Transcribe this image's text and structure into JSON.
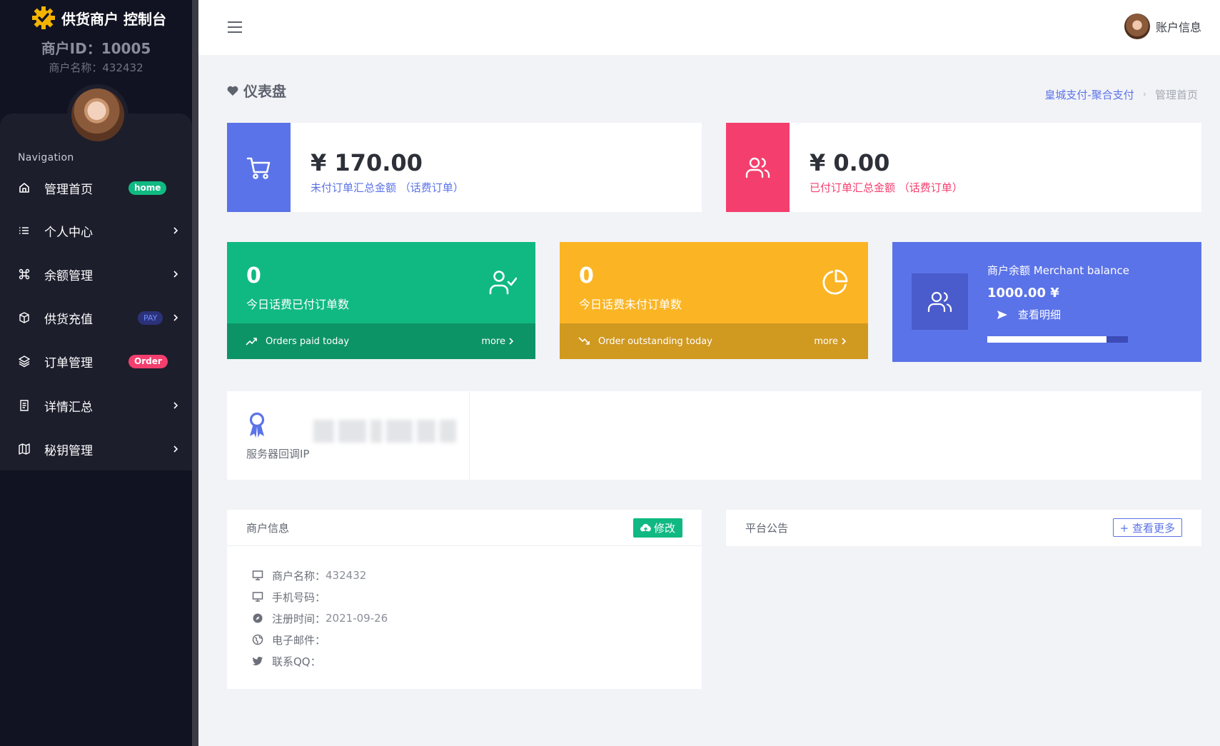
{
  "sidebar": {
    "brand_title": "供货商户 控制台",
    "merchant_id": "商户ID：10005",
    "merchant_name": "商户名称：432432",
    "nav_heading": "Navigation",
    "items": [
      {
        "label": "管理首页",
        "icon": "home-icon",
        "badge": "home"
      },
      {
        "label": "个人中心",
        "icon": "list-icon"
      },
      {
        "label": "余额管理",
        "icon": "command-icon"
      },
      {
        "label": "供货充值",
        "icon": "box-icon",
        "badge": "PAY"
      },
      {
        "label": "订单管理",
        "icon": "layers-icon",
        "badge": "Order"
      },
      {
        "label": "详情汇总",
        "icon": "document-icon"
      },
      {
        "label": "秘钥管理",
        "icon": "map-icon"
      }
    ]
  },
  "topbar": {
    "user_label": "账户信息"
  },
  "page": {
    "title": "仪表盘",
    "breadcrumb": {
      "link": "皇城支付-聚合支付",
      "current": "管理首页"
    }
  },
  "summary": {
    "unpaid": {
      "amount": "¥ 170.00",
      "label": "未付订单汇总金额 （话费订单）",
      "color": "#5b73e8"
    },
    "paid": {
      "amount": "¥ 0.00",
      "label": "已付订单汇总金额 （话费订单）",
      "color": "#f43f6e"
    }
  },
  "tiles": {
    "paid_today": {
      "value": "0",
      "label": "今日话费已付订单数",
      "footer": "Orders paid today",
      "more": "more",
      "color": "#10b981",
      "footer_color": "#0d9466"
    },
    "outstanding_today": {
      "value": "0",
      "label": "今日话费未付订单数",
      "footer": "Order outstanding today",
      "more": "more",
      "color": "#fbb524",
      "footer_color": "#d09920"
    }
  },
  "balance": {
    "title": "商户余额 Merchant balance",
    "amount": "1000.00 ¥",
    "detail_link": "查看明细",
    "progress_fraction": 0.85,
    "color": "#5b73e8"
  },
  "server_ip": {
    "label": "服务器回调IP"
  },
  "merchant_info": {
    "title": "商户信息",
    "edit_button": "修改",
    "rows": [
      {
        "label": "商户名称：",
        "value": "432432",
        "icon": "monitor-icon"
      },
      {
        "label": "手机号码：",
        "value": "",
        "icon": "monitor-icon"
      },
      {
        "label": "注册时间：",
        "value": "2021-09-26",
        "icon": "compass-icon"
      },
      {
        "label": "电子邮件：",
        "value": "",
        "icon": "globe-icon"
      },
      {
        "label": "联系QQ：",
        "value": "",
        "icon": "twitter-icon"
      }
    ]
  },
  "notice": {
    "title": "平台公告",
    "more_button": "+ 查看更多"
  }
}
